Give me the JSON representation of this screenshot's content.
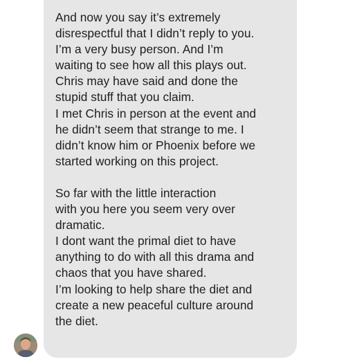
{
  "message": {
    "paragraph1": [
      "And now you say it’s extremely",
      "disrespectful that I didn’t reply to you.",
      "I’m a very busy person. And I’m",
      "waiting to see how all this plays out.",
      "Chris may have said and done the",
      "stupid stuff that you claim.",
      "I met Chris in person at the event and",
      "he didn’t seem that strange to me. I",
      "didn’t know him or Phoenix before we",
      "started working on this project."
    ],
    "paragraph2": [
      "So far with the little interaction",
      "with you here you seem very over",
      "dramatic.",
      "I dont want the primal diet to have",
      "anything to do with all this drama and",
      "chaos that you have shared.",
      "I’m looking to help share the diet and",
      "create a new peaceful culture around",
      "the diet."
    ]
  },
  "sender": {
    "avatar_icon": "user-avatar-photo"
  },
  "colors": {
    "bubble_background": "#e6e6e6",
    "text": "#1c1e21",
    "page_background": "#ffffff"
  }
}
